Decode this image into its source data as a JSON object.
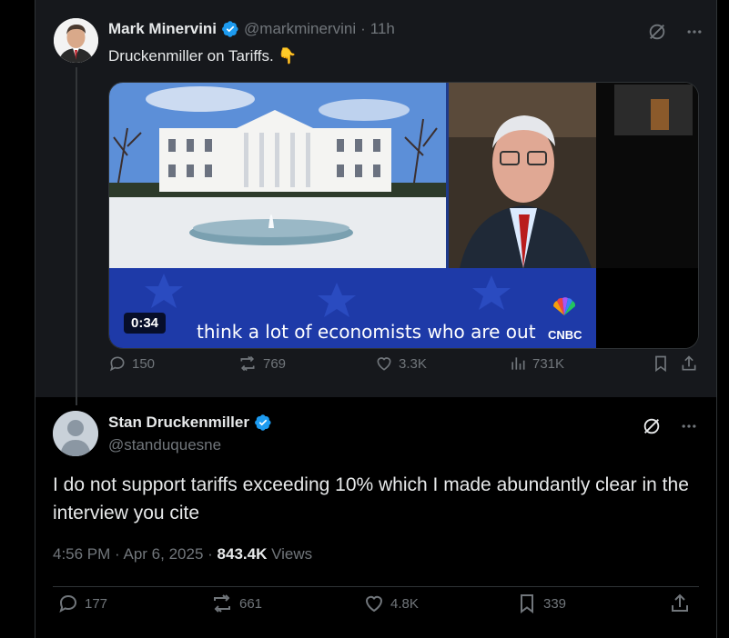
{
  "parent_tweet": {
    "author_name": "Mark Minervini",
    "handle": "@markminervini",
    "separator": "·",
    "time": "11h",
    "text": "Druckenmiller on Tariffs. 👇",
    "video": {
      "duration": "0:34",
      "caption": "think a lot of economists who are out",
      "network_logo": "CNBC"
    },
    "stats": {
      "replies": "150",
      "reposts": "769",
      "likes": "3.3K",
      "views": "731K"
    }
  },
  "reply_tweet": {
    "author_name": "Stan Druckenmiller",
    "handle": "@standuquesne",
    "text": "I do not support tariffs exceeding 10% which I made abundantly clear in the interview you cite",
    "time": "4:56 PM",
    "date": "Apr 6, 2025",
    "views_count": "843.4K",
    "views_label": "Views",
    "stats": {
      "replies": "177",
      "reposts": "661",
      "likes": "4.8K",
      "bookmarks": "339"
    }
  },
  "colors": {
    "background": "#000000",
    "parent_background": "#16181c",
    "text_primary": "#e7e9ea",
    "text_secondary": "#71767b",
    "verified_blue": "#1d9bf0",
    "border": "#2f3336"
  },
  "icons": [
    "verified-badge-icon",
    "grok-icon",
    "more-icon",
    "reply-icon",
    "repost-icon",
    "like-icon",
    "views-icon",
    "bookmark-icon",
    "share-icon",
    "pointing-down-emoji"
  ]
}
